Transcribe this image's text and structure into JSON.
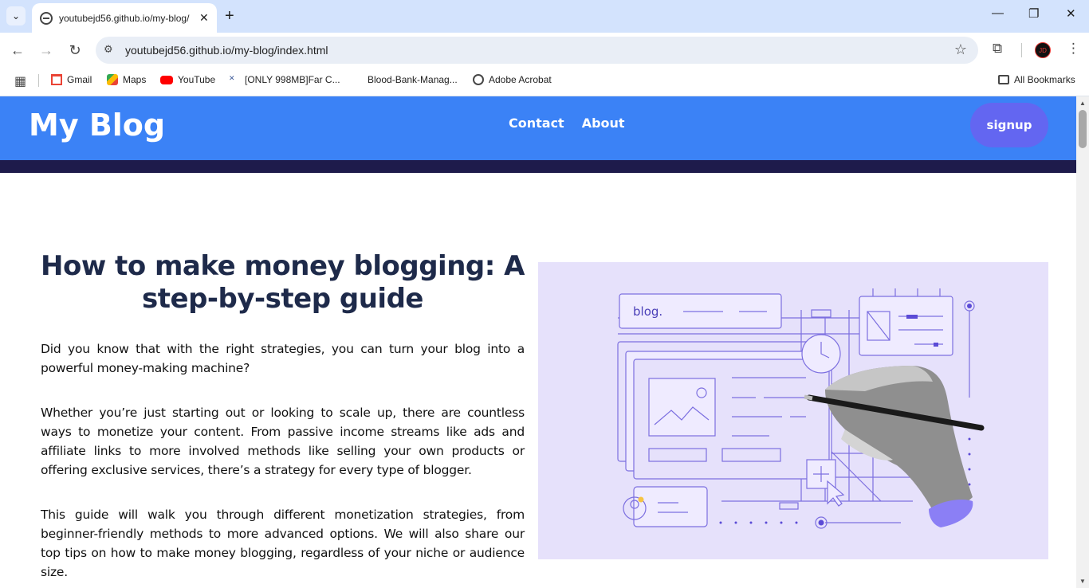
{
  "browser": {
    "tab_title": "youtubejd56.github.io/my-blog/",
    "url": "youtubejd56.github.io/my-blog/index.html",
    "profile_initials": "JD",
    "bookmarks": [
      {
        "label": "Gmail"
      },
      {
        "label": "Maps"
      },
      {
        "label": "YouTube"
      },
      {
        "label": "[ONLY 998MB]Far C..."
      },
      {
        "label": "Blood-Bank-Manag..."
      },
      {
        "label": "Adobe Acrobat"
      }
    ],
    "all_bookmarks_label": "All Bookmarks"
  },
  "site": {
    "logo": "My Blog",
    "nav": [
      "Contact",
      "About"
    ],
    "signup_label": "signup",
    "colors": {
      "header": "#3b82f6",
      "strip": "#1e1b4b",
      "signup": "#6366f1",
      "title": "#1e2a4a",
      "illustration_bg": "#e6e1fb"
    }
  },
  "hero": {
    "title": "How to make money blogging: A step-by-step guide",
    "paragraphs": [
      "Did you know that with the right strategies, you can turn your blog into a powerful money-making machine?",
      "Whether you’re just starting out or looking to scale up, there are countless ways to monetize your content. From passive income streams like ads and affiliate links to more involved methods like selling your own products or offering exclusive services, there’s a strategy for every type of blogger.",
      "This guide will walk you through different monetization strategies, from beginner-friendly methods to more advanced options. We will also share our top tips on how to make money blogging, regardless of your niche or audience size."
    ],
    "illustration_text": "blog."
  }
}
